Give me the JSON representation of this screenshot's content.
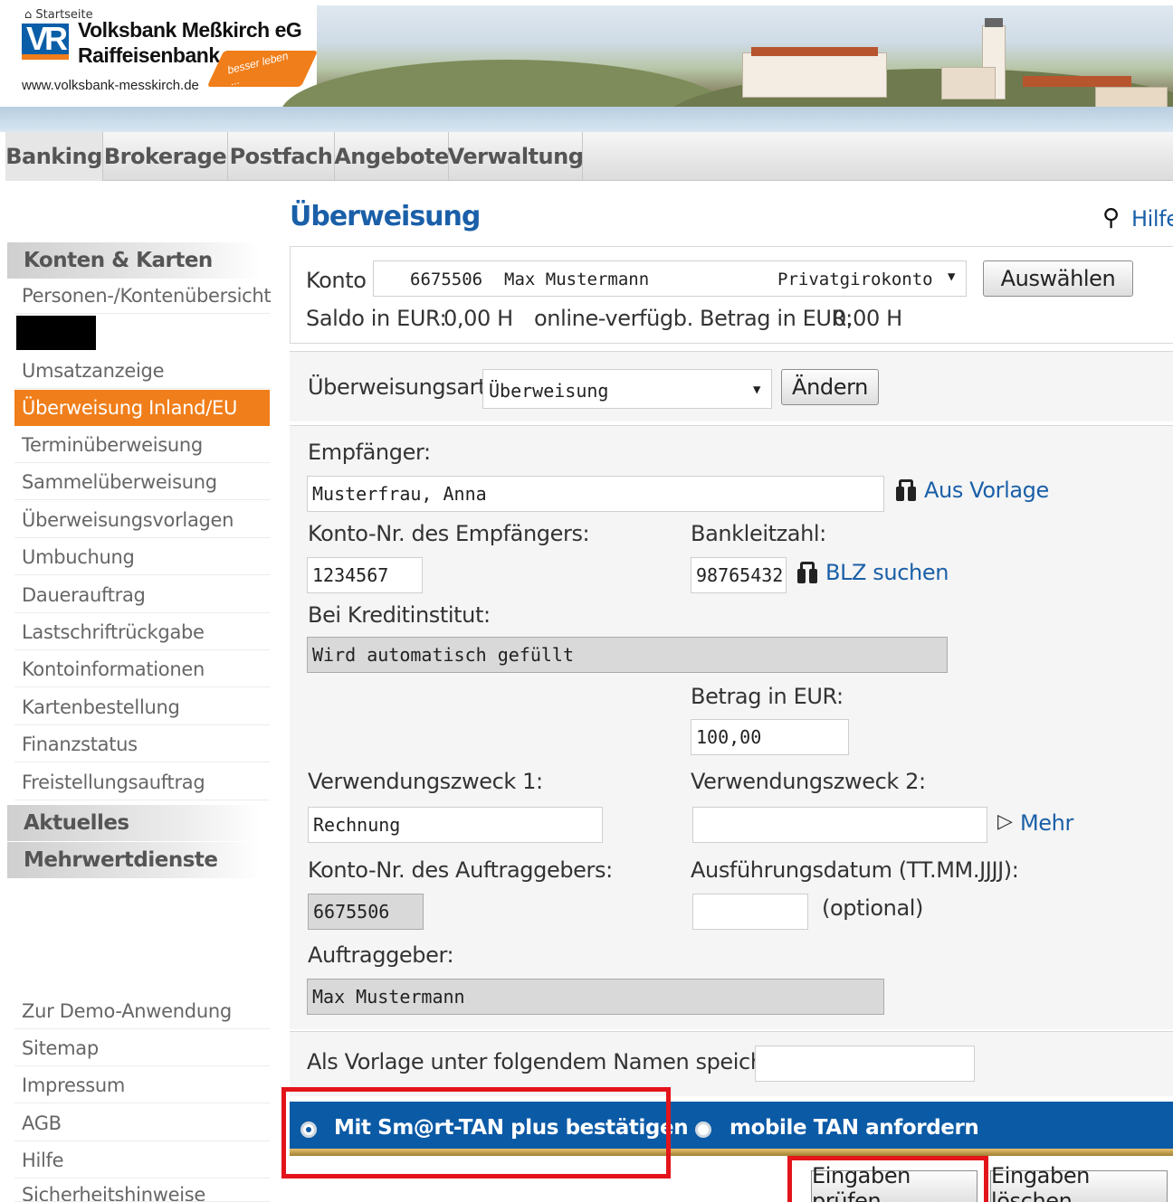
{
  "header": {
    "home_link": "Startseite",
    "bank_name_1": "Volksbank Meßkirch eG",
    "bank_name_2": "Raiffeisenbank",
    "url": "www.volksbank-messkirch.de",
    "slogan": "besser leben ..."
  },
  "tabs": [
    {
      "label": "Banking"
    },
    {
      "label": "Brokerage"
    },
    {
      "label": "Postfach"
    },
    {
      "label": "Angebote"
    },
    {
      "label": "Verwaltung"
    }
  ],
  "sidebar": {
    "section_konten": "Konten & Karten",
    "items": [
      "Personen-/Kontenübersicht",
      "Umsatzanzeige",
      "Überweisung Inland/EU",
      "Terminüberweisung",
      "Sammelüberweisung",
      "Überweisungsvorlagen",
      "Umbuchung",
      "Dauerauftrag",
      "Lastschriftrückgabe",
      "Kontoinformationen",
      "Kartenbestellung",
      "Finanzstatus",
      "Freistellungsauftrag"
    ],
    "section_aktuelles": "Aktuelles",
    "section_mehrwert": "Mehrwertdienste",
    "footer_items": [
      "Zur Demo-Anwendung",
      "Sitemap",
      "Impressum",
      "AGB",
      "Hilfe",
      "Sicherheitshinweise"
    ]
  },
  "page": {
    "title": "Überweisung",
    "help": "Hilfe"
  },
  "account": {
    "label": "Konto",
    "number": "6675506",
    "holder": "Max Mustermann",
    "type": "Privatgirokonto",
    "select_button": "Auswählen",
    "saldo_label": "Saldo in EUR:",
    "saldo_value": "0,00 H",
    "available_label": "online-verfügb. Betrag in EUR:",
    "available_value": "0,00 H"
  },
  "transfer_type": {
    "label": "Überweisungsart:",
    "value": "Überweisung",
    "change_button": "Ändern"
  },
  "form": {
    "recipient_label": "Empfänger:",
    "recipient_value": "Musterfrau, Anna",
    "from_template_link": "Aus Vorlage",
    "recipient_account_label": "Konto-Nr. des Empfängers:",
    "recipient_account_value": "1234567",
    "blz_label": "Bankleitzahl:",
    "blz_value": "98765432",
    "blz_search_link": "BLZ suchen",
    "institute_label": "Bei Kreditinstitut:",
    "institute_value": "Wird automatisch gefüllt",
    "amount_label": "Betrag in EUR:",
    "amount_value": "100,00",
    "purpose1_label": "Verwendungszweck 1:",
    "purpose1_value": "Rechnung",
    "purpose2_label": "Verwendungszweck 2:",
    "purpose2_value": "",
    "more_link": "Mehr",
    "sender_account_label": "Konto-Nr. des Auftraggebers:",
    "sender_account_value": "6675506",
    "date_label": "Ausführungsdatum (TT.MM.JJJJ):",
    "date_value": "",
    "date_optional": "(optional)",
    "sender_label": "Auftraggeber:",
    "sender_value": "Max Mustermann",
    "template_save_label": "Als Vorlage unter folgendem Namen speichern:",
    "template_save_value": ""
  },
  "tan": {
    "option1": "Mit Sm@rt-TAN plus bestätigen",
    "option2": "mobile TAN anfordern"
  },
  "actions": {
    "check": "Eingaben prüfen",
    "clear": "Eingaben löschen"
  },
  "colors": {
    "brand_blue": "#0b5aa6",
    "accent_orange": "#f07e1a",
    "highlight_red": "#e4141b"
  }
}
